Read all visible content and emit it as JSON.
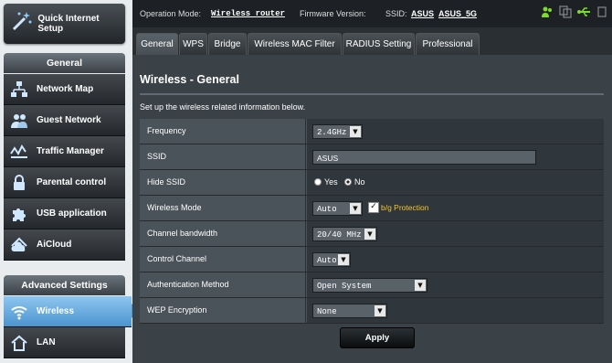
{
  "sidebar": {
    "quick_setup": "Quick Internet Setup",
    "general_header": "General",
    "general_items": [
      "Network Map",
      "Guest Network",
      "Traffic Manager",
      "Parental control",
      "USB application",
      "AiCloud"
    ],
    "advanced_header": "Advanced Settings",
    "advanced_items": [
      "Wireless",
      "LAN"
    ]
  },
  "topbar": {
    "op_mode_label": "Operation Mode:",
    "op_mode_value": "Wireless router",
    "firmware_label": "Firmware Version:",
    "ssid_label": "SSID:",
    "ssid_value_1": "ASUS",
    "ssid_value_2": "ASUS_5G"
  },
  "tabs": [
    "General",
    "WPS",
    "Bridge",
    "Wireless MAC Filter",
    "RADIUS Setting",
    "Professional"
  ],
  "main": {
    "title": "Wireless - General",
    "description": "Set up the wireless related information below.",
    "fields": {
      "frequency": {
        "label": "Frequency",
        "value": "2.4GHz"
      },
      "ssid": {
        "label": "SSID",
        "value": "ASUS"
      },
      "hide_ssid": {
        "label": "Hide SSID",
        "yes": "Yes",
        "no": "No",
        "selected": "No"
      },
      "wireless_mode": {
        "label": "Wireless Mode",
        "value": "Auto",
        "bg_protection": "b/g Protection",
        "bg_checked": true
      },
      "channel_bandwidth": {
        "label": "Channel bandwidth",
        "value": "20/40 MHz"
      },
      "control_channel": {
        "label": "Control Channel",
        "value": "Auto"
      },
      "auth_method": {
        "label": "Authentication Method",
        "value": "Open System"
      },
      "wep": {
        "label": "WEP Encryption",
        "value": "None"
      }
    },
    "apply_label": "Apply"
  },
  "colors": {
    "active_nav": "#4a94cf",
    "accent_yellow": "#f4c430",
    "panel_bg": "#3b4247"
  }
}
